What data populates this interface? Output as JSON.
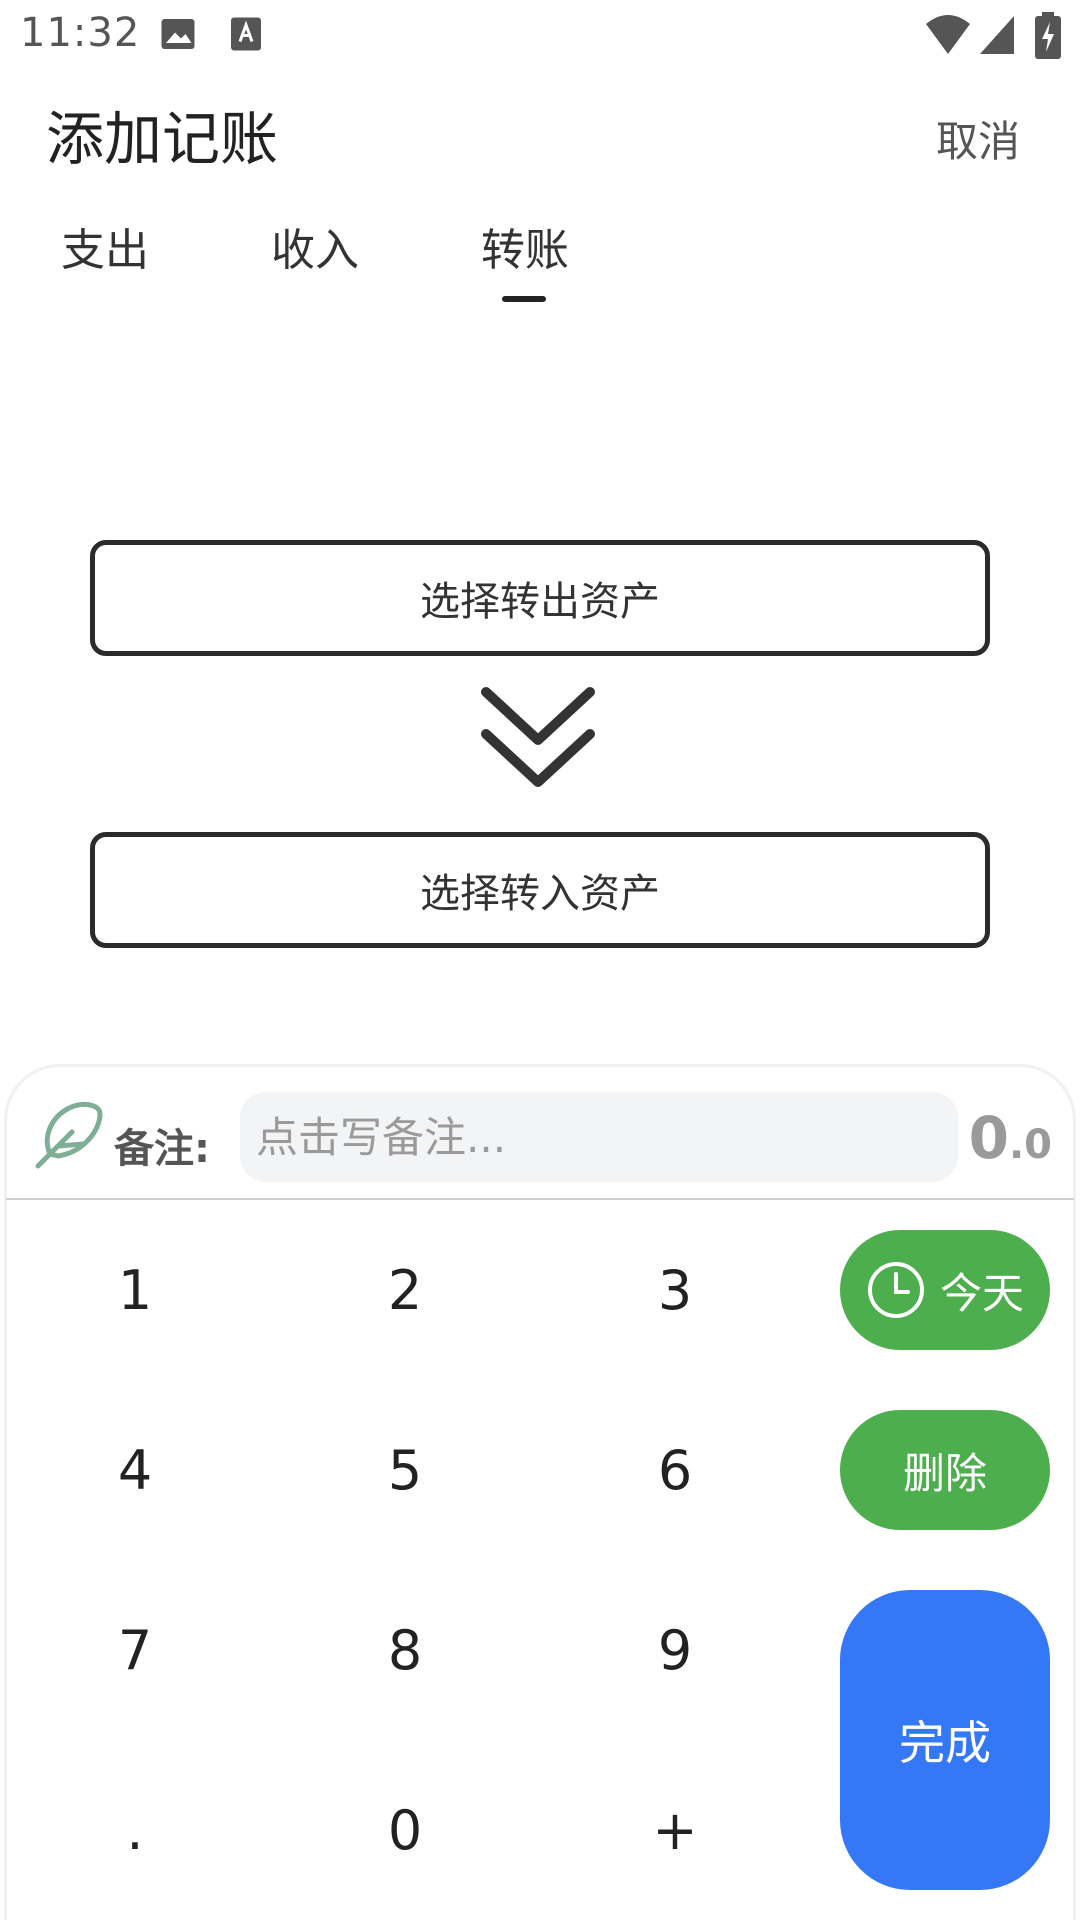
{
  "status_bar": {
    "time": "11:32",
    "icons": [
      "gallery-icon",
      "text-a-icon",
      "wifi-icon",
      "signal-icon",
      "battery-charging-icon"
    ]
  },
  "header": {
    "title": "添加记账",
    "cancel_label": "取消"
  },
  "tabs": [
    {
      "label": "支出",
      "selected": false
    },
    {
      "label": "收入",
      "selected": false
    },
    {
      "label": "转账",
      "selected": true
    }
  ],
  "transfer": {
    "from_label": "选择转出资产",
    "to_label": "选择转入资产"
  },
  "memo": {
    "label": "备注:",
    "placeholder": "点击写备注..."
  },
  "amount": {
    "integer": "0",
    "decimal": ".0"
  },
  "keypad": {
    "keys": [
      "1",
      "2",
      "3",
      "4",
      "5",
      "6",
      "7",
      "8",
      "9",
      ".",
      "0",
      "+"
    ]
  },
  "actions": {
    "today_label": "今天",
    "delete_label": "删除",
    "done_label": "完成"
  },
  "colors": {
    "green": "#4cae4c",
    "blue": "#3478f6"
  }
}
